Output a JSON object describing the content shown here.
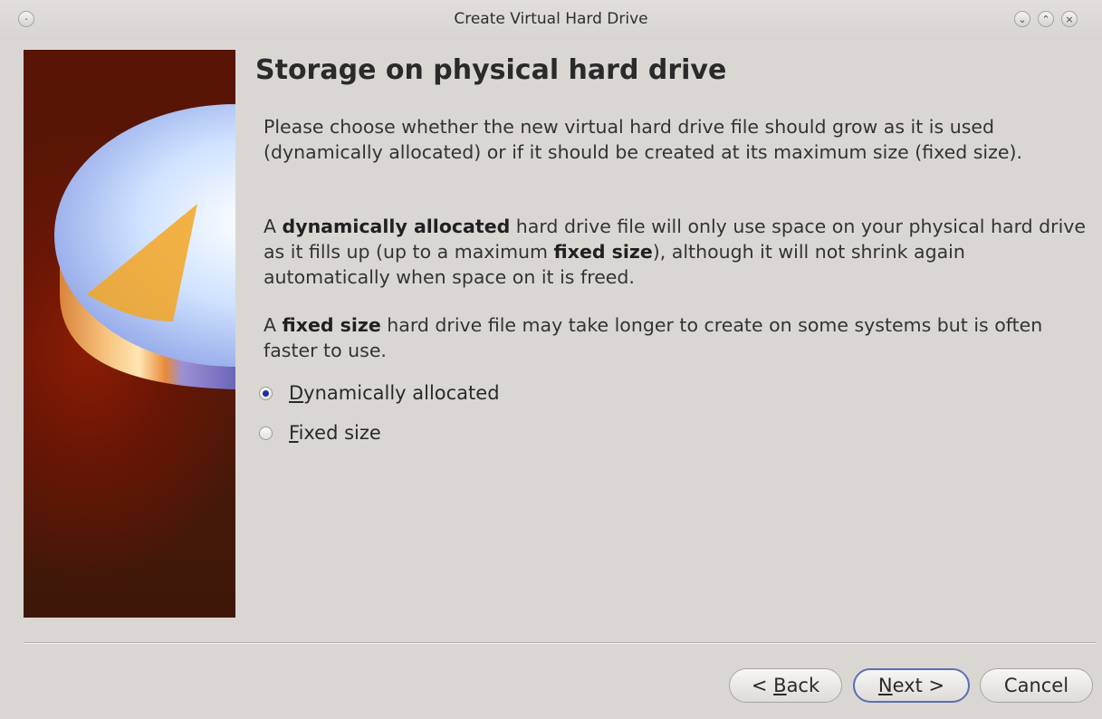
{
  "window": {
    "title": "Create Virtual Hard Drive",
    "controls": {
      "menu_glyph": "·",
      "minimize_glyph": "⌄",
      "maximize_glyph": "⌃",
      "close_glyph": "×"
    }
  },
  "page": {
    "heading": "Storage on physical hard drive",
    "paragraph1": "Please choose whether the new virtual hard drive file should grow as it is used (dynamically allocated) or if it should be created at its maximum size (fixed size).",
    "paragraph2": {
      "part1": "A ",
      "bold1": "dynamically allocated",
      "part2": " hard drive file will only use space on your physical hard drive as it fills up (up to a maximum ",
      "bold2": "fixed size",
      "part3": "), although it will not shrink again automatically when space on it is freed."
    },
    "paragraph3": {
      "part1": "A ",
      "bold1": "fixed size",
      "part2": " hard drive file may take longer to create on some systems but is often faster to use."
    }
  },
  "options": [
    {
      "mnemonic": "D",
      "rest": "ynamically allocated",
      "checked": true
    },
    {
      "mnemonic": "F",
      "rest": "ixed size",
      "checked": false
    }
  ],
  "buttons": {
    "back": {
      "prefix": "< ",
      "mnemonic": "B",
      "rest": "ack"
    },
    "next": {
      "mnemonic": "N",
      "rest": "ext >"
    },
    "cancel": "Cancel"
  },
  "colors": {
    "radio_checked": "#1e2fa0",
    "default_button_border": "#5a6fb5",
    "side_panel": "#5a1406"
  }
}
